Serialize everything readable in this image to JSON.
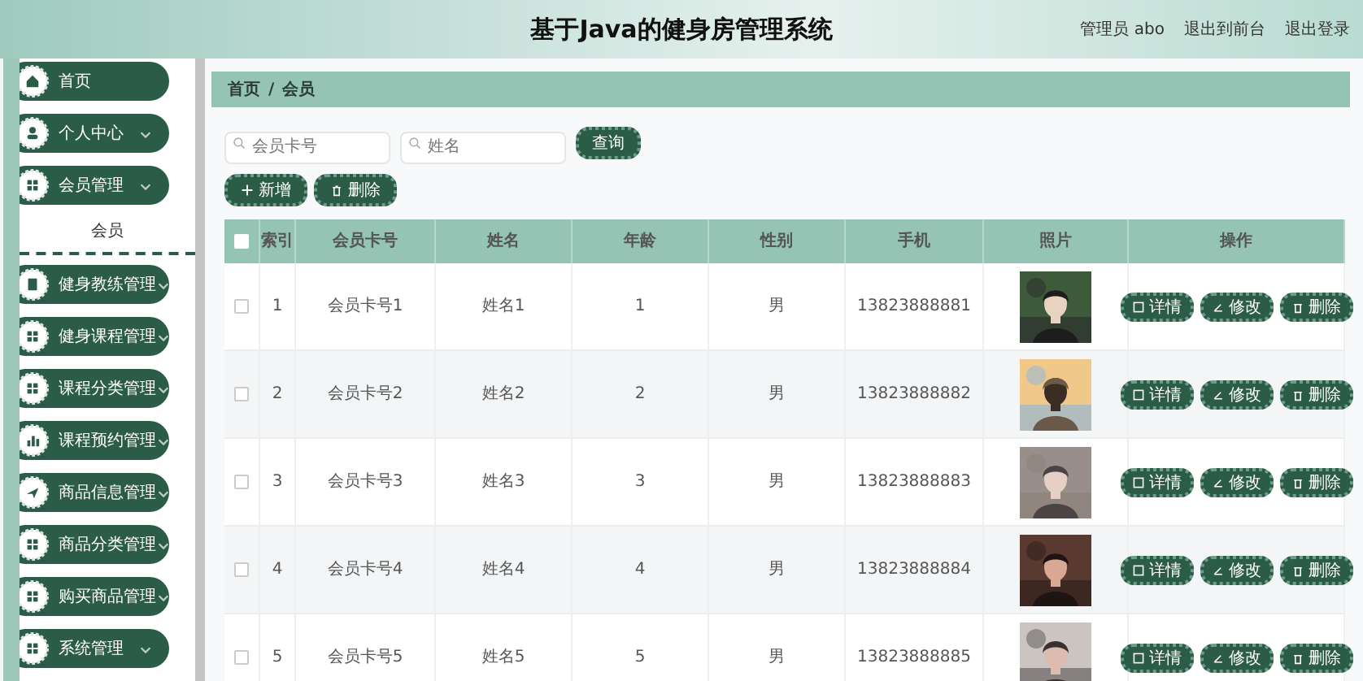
{
  "header": {
    "title": "基于Java的健身房管理系统",
    "links": [
      "管理员 abo",
      "退出到前台",
      "退出登录"
    ]
  },
  "sidebar": {
    "items": [
      {
        "label": "首页",
        "kind": "link"
      },
      {
        "label": "个人中心",
        "kind": "menu"
      },
      {
        "label": "会员管理",
        "kind": "menu",
        "children": [
          {
            "label": "会员",
            "selected": true
          }
        ]
      },
      {
        "label": "健身教练管理",
        "kind": "menu"
      },
      {
        "label": "健身课程管理",
        "kind": "menu"
      },
      {
        "label": "课程分类管理",
        "kind": "menu"
      },
      {
        "label": "课程预约管理",
        "kind": "menu"
      },
      {
        "label": "商品信息管理",
        "kind": "menu"
      },
      {
        "label": "商品分类管理",
        "kind": "menu"
      },
      {
        "label": "购买商品管理",
        "kind": "menu"
      },
      {
        "label": "系统管理",
        "kind": "menu"
      }
    ]
  },
  "breadcrumb": {
    "items": [
      "首页",
      "会员"
    ],
    "separator": "/"
  },
  "search": {
    "fields": [
      {
        "placeholder": "会员卡号"
      },
      {
        "placeholder": "姓名"
      }
    ],
    "button": "查询"
  },
  "toolbar": [
    {
      "label": "新增",
      "kind": "add"
    },
    {
      "label": "删除",
      "kind": "delete"
    }
  ],
  "table": {
    "select_all": {
      "checked": false
    },
    "columns": [
      "索引",
      "会员卡号",
      "姓名",
      "年龄",
      "性别",
      "手机",
      "照片",
      "操作"
    ],
    "rows": [
      {
        "checked": false,
        "cells": [
          "1",
          "会员卡号1",
          "姓名1",
          "1",
          "男",
          "13823888881"
        ],
        "actions": [
          "详情",
          "修改",
          "删除"
        ]
      },
      {
        "checked": false,
        "cells": [
          "2",
          "会员卡号2",
          "姓名2",
          "2",
          "男",
          "13823888882"
        ],
        "actions": [
          "详情",
          "修改",
          "删除"
        ]
      },
      {
        "checked": false,
        "cells": [
          "3",
          "会员卡号3",
          "姓名3",
          "3",
          "男",
          "13823888883"
        ],
        "actions": [
          "详情",
          "修改",
          "删除"
        ]
      },
      {
        "checked": false,
        "cells": [
          "4",
          "会员卡号4",
          "姓名4",
          "4",
          "男",
          "13823888884"
        ],
        "actions": [
          "详情",
          "修改",
          "删除"
        ]
      },
      {
        "checked": false,
        "cells": [
          "5",
          "会员卡号5",
          "姓名5",
          "5",
          "男",
          "13823888885"
        ],
        "actions": [
          "详情",
          "修改",
          "删除"
        ]
      }
    ]
  }
}
